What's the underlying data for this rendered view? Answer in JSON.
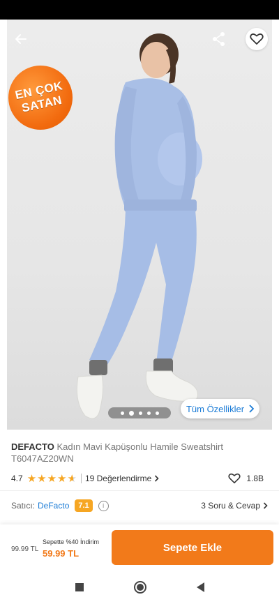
{
  "product": {
    "brand": "DEFACTO",
    "name": "Kadın Mavi Kapüşonlu Hamile Sweatshirt",
    "code": "T6047AZ20WN",
    "badge_line1": "EN ÇOK",
    "badge_line2": "SATAN",
    "all_features_label": "Tüm Özellikler",
    "image_count": 5,
    "active_image": 2
  },
  "rating": {
    "score": "4.7",
    "stars": 4.7,
    "reviews_label": "19 Değerlendirme",
    "favorites": "1.8B"
  },
  "seller": {
    "label": "Satıcı:",
    "name": "DeFacto",
    "score": "7.1",
    "qa_label": "3 Soru & Cevap"
  },
  "cart": {
    "old_price": "99.99 TL",
    "campaign": "Sepette %40 İndirim",
    "new_price": "59.99 TL",
    "add_label": "Sepete Ekle"
  },
  "colors": {
    "accent": "#f27a1a",
    "link": "#1a7bd6",
    "star": "#f6a623"
  }
}
